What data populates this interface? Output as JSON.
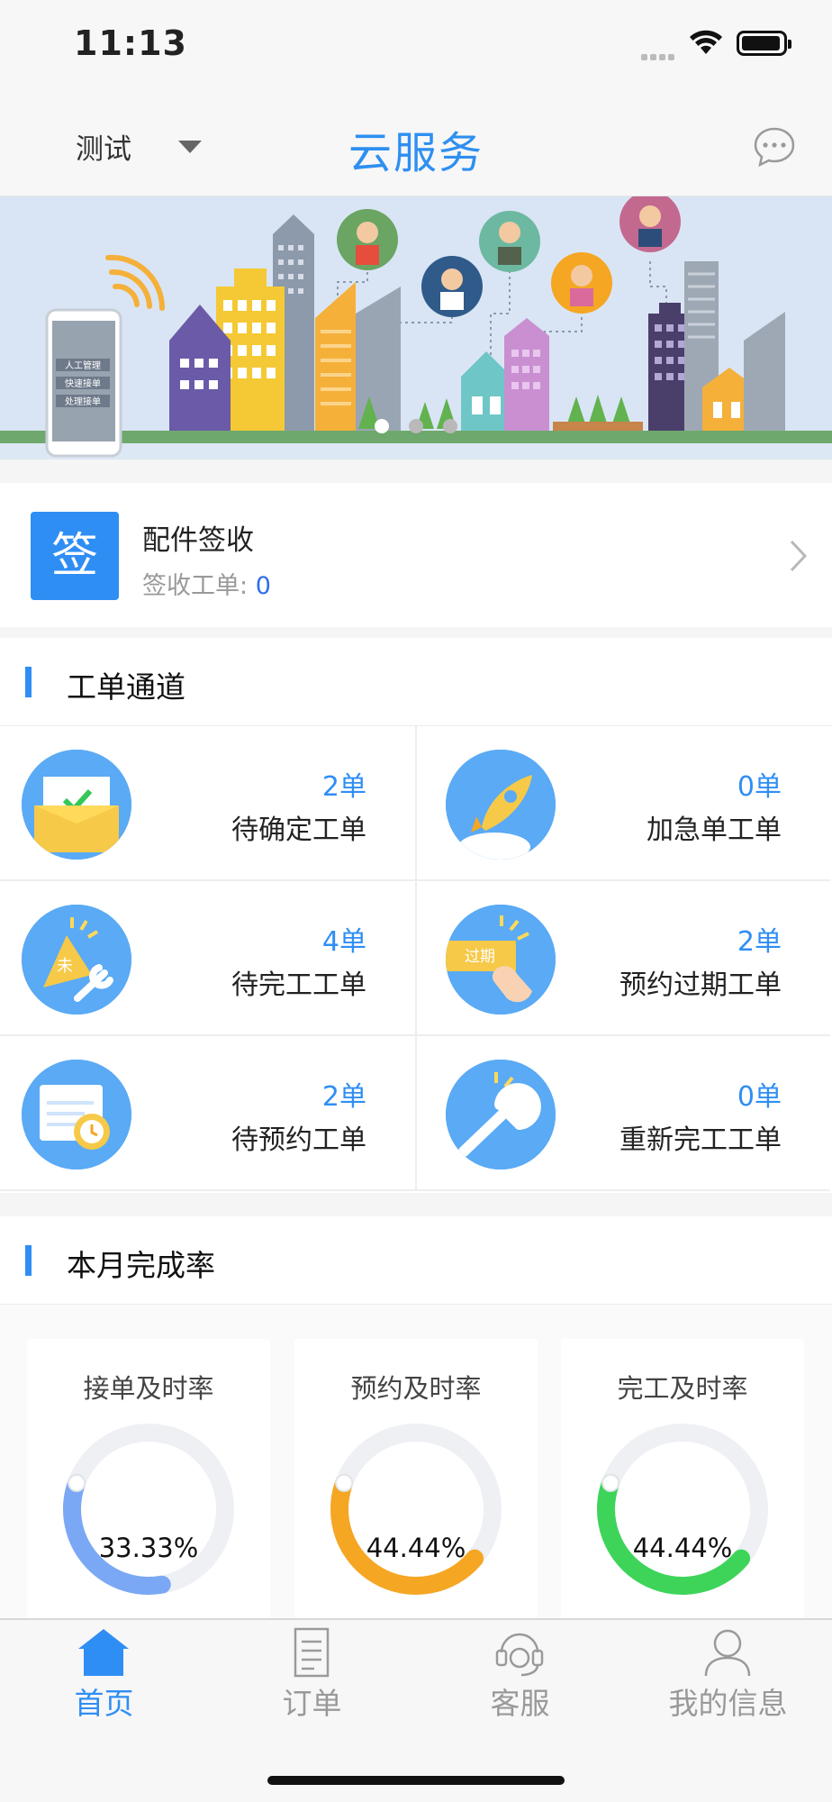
{
  "status_bar": {
    "time": "11:13"
  },
  "nav": {
    "city": "测试",
    "title": "云服务"
  },
  "banner": {
    "phone_lines": [
      "人工管理",
      "快速接单",
      "处理接单"
    ],
    "dots": 3,
    "active_dot": 0
  },
  "sign_card": {
    "badge": "签",
    "title": "配件签收",
    "subtitle": "签收工单:",
    "count": "0"
  },
  "work_channel": {
    "heading": "工单通道",
    "items": [
      {
        "count": "2单",
        "name": "待确定工单",
        "icon": "envelope-check-icon"
      },
      {
        "count": "0单",
        "name": "加急单工单",
        "icon": "rocket-icon"
      },
      {
        "count": "4单",
        "name": "待完工工单",
        "icon": "unfinished-wrench-icon"
      },
      {
        "count": "2单",
        "name": "预约过期工单",
        "icon": "expired-tag-icon"
      },
      {
        "count": "2单",
        "name": "待预约工单",
        "icon": "calendar-clock-icon"
      },
      {
        "count": "0单",
        "name": "重新完工工单",
        "icon": "wrench-icon"
      }
    ]
  },
  "monthly": {
    "heading": "本月完成率",
    "rates": [
      {
        "title": "接单及时率",
        "value": "33.33%",
        "fraction": 0.3333,
        "color": "#7aa8f4"
      },
      {
        "title": "预约及时率",
        "value": "44.44%",
        "fraction": 0.4444,
        "color": "#f5a623"
      },
      {
        "title": "完工及时率",
        "value": "44.44%",
        "fraction": 0.4444,
        "color": "#3ed45a"
      }
    ]
  },
  "tabs": [
    {
      "label": "首页",
      "icon": "home-icon",
      "active": true
    },
    {
      "label": "订单",
      "icon": "order-document-icon",
      "active": false
    },
    {
      "label": "客服",
      "icon": "headset-icon",
      "active": false
    },
    {
      "label": "我的信息",
      "icon": "user-icon",
      "active": false
    }
  ],
  "colors": {
    "accent": "#2f8ef4",
    "muted": "#999999"
  }
}
